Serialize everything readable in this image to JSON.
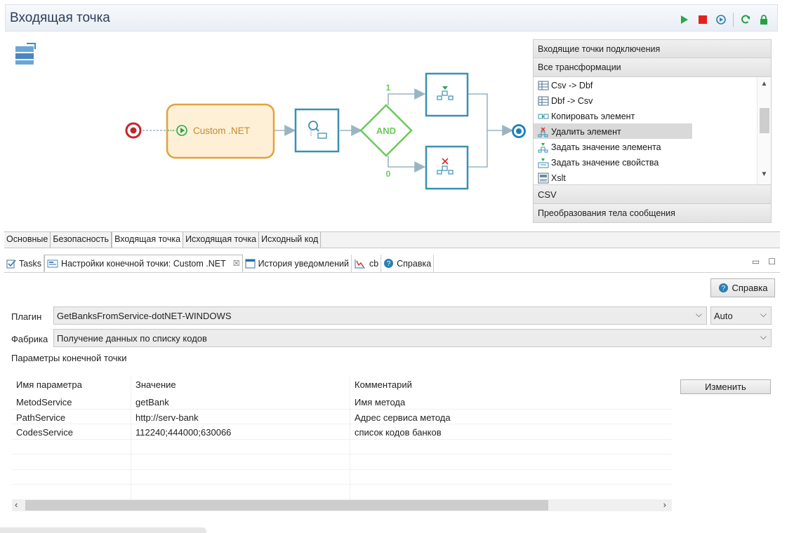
{
  "header": {
    "title": "Входящая точка"
  },
  "diagram": {
    "custom_node_label": "Custom .NET",
    "gateway_label": "AND",
    "branch_true_label": "1",
    "branch_false_label": "0"
  },
  "palette": {
    "sections_top": [
      "Входящие точки подключения",
      "Все трансформации"
    ],
    "items": [
      {
        "label": "Csv -> Dbf",
        "icon": "table-icon"
      },
      {
        "label": "Dbf -> Csv",
        "icon": "table-icon"
      },
      {
        "label": "Копировать элемент",
        "icon": "copy-element-icon"
      },
      {
        "label": "Удалить элемент",
        "icon": "delete-element-icon",
        "selected": true
      },
      {
        "label": "Задать значение элемента",
        "icon": "set-element-value-icon"
      },
      {
        "label": "Задать значение свойства",
        "icon": "set-property-value-icon"
      },
      {
        "label": "Xslt",
        "icon": "xslt-icon"
      }
    ],
    "sections_bottom": [
      "CSV",
      "Преобразования тела сообщения"
    ]
  },
  "editor_tabs": [
    {
      "label": "Основные",
      "active": false
    },
    {
      "label": "Безопасность",
      "active": false
    },
    {
      "label": "Входящая точка",
      "active": true
    },
    {
      "label": "Исходящая точка",
      "active": false
    },
    {
      "label": "Исходный код",
      "active": false
    }
  ],
  "view_tabs": [
    {
      "label": "Tasks",
      "icon": "tasks-icon",
      "active": false
    },
    {
      "label": "Настройки конечной точки: Custom .NET",
      "icon": "endpoint-settings-icon",
      "active": true,
      "closable": true
    },
    {
      "label": "История уведомлений",
      "icon": "history-icon",
      "active": false
    },
    {
      "label": "cb",
      "icon": "chart-icon",
      "active": false
    },
    {
      "label": "Справка",
      "icon": "help-icon",
      "active": false
    }
  ],
  "form": {
    "help_button": "Справка",
    "plugin_label": "Плагин",
    "plugin_value": "GetBanksFromService-dotNET-WINDOWS",
    "platform_value": "Auto",
    "factory_label": "Фабрика",
    "factory_value": "Получение данных по списку кодов",
    "params_title": "Параметры конечной точки",
    "change_button": "Изменить"
  },
  "params_table": {
    "columns": [
      "Имя параметра",
      "Значение",
      "Комментарий"
    ],
    "rows": [
      [
        "MetodService",
        "getBank",
        "Имя метода"
      ],
      [
        "PathService",
        "http://serv-bank",
        "Адрес сервиса метода"
      ],
      [
        "CodesService",
        "112240;444000;630066",
        "список кодов банков"
      ]
    ],
    "empty_rows": 4
  },
  "colors": {
    "accent_blue": "#3a8fb7",
    "custom_node_border": "#e2a23c",
    "custom_node_fill": "#fdf0d6",
    "gateway_green": "#6cc95b",
    "start_red": "#c0262b",
    "header_title": "#2d3e58"
  }
}
